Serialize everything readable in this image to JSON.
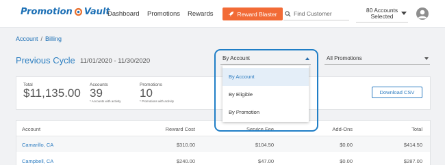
{
  "brand": {
    "logo_text_a": "Promotion",
    "logo_text_b": "Vault"
  },
  "nav": {
    "dashboard": "Dashboard",
    "promotions": "Promotions",
    "rewards": "Rewards",
    "reward_blaster": "Reward Blaster",
    "search_placeholder": "Find Customer",
    "accounts_line1": "80 Accounts",
    "accounts_line2": "Selected"
  },
  "breadcrumb": {
    "account": "Account",
    "separator": "/",
    "billing": "Billing"
  },
  "header": {
    "title": "Previous Cycle",
    "date_range": "11/01/2020 - 11/30/2020",
    "group_select": "By Account",
    "promo_select": "All Promotions"
  },
  "summary": {
    "total_label": "Total",
    "total_value": "$11,135.00",
    "accounts_label": "Accounts",
    "accounts_value": "39",
    "accounts_note": "* Accounts with activity",
    "promotions_label": "Promotions",
    "promotions_value": "10",
    "promotions_note": "* Promotions with activity",
    "download_csv": "Download CSV"
  },
  "table": {
    "headers": {
      "account": "Account",
      "reward_cost": "Reward Cost",
      "service_fee": "Service Fee",
      "add_ons": "Add-Ons",
      "total": "Total"
    },
    "rows": [
      {
        "account": "Camarillo, CA",
        "reward_cost": "$310.00",
        "service_fee": "$104.50",
        "add_ons": "$0.00",
        "total": "$414.50"
      },
      {
        "account": "Campbell, CA",
        "reward_cost": "$240.00",
        "service_fee": "$47.00",
        "add_ons": "$0.00",
        "total": "$287.00"
      }
    ]
  },
  "dropdown": {
    "options": [
      "By Account",
      "By Eligible",
      "By Promotion"
    ],
    "selected": "By Account"
  },
  "colors": {
    "brand_blue": "#1b6fb5",
    "accent_orange": "#f26b36",
    "highlight_blue": "#1f7ec6"
  }
}
